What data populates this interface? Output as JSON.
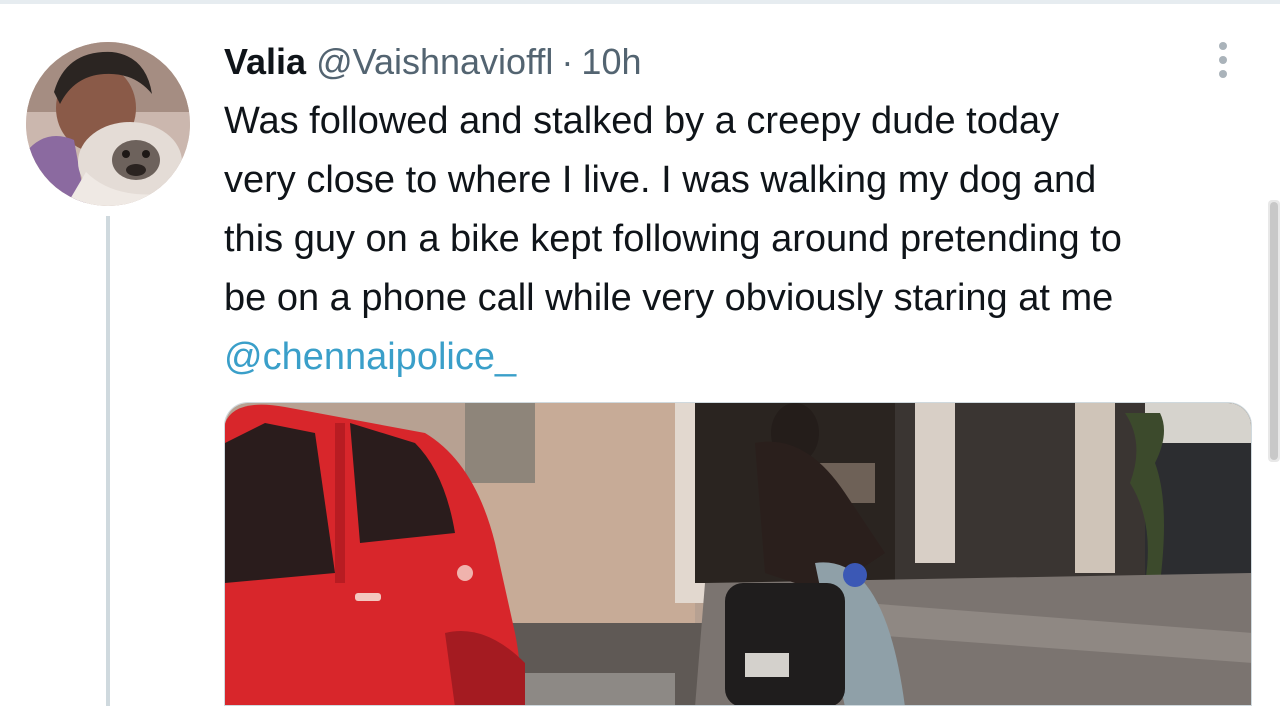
{
  "tweet": {
    "display_name": "Valia",
    "handle": "@Vaishnavioffl",
    "separator": "·",
    "time": "10h",
    "text_lines": [
      "Was followed and stalked by a creepy dude today",
      "very close to where I live. I was walking my dog and",
      "this guy on a bike kept following around pretending to",
      "be on a phone call while very obviously staring at me"
    ],
    "mention": "@chennaipolice_"
  },
  "icons": {
    "more": "more-horizontal-icon",
    "avatar": "avatar-photo"
  },
  "colors": {
    "text": "#0f1419",
    "secondary": "#536471",
    "mention": "#3a9fc9",
    "thread_line": "#cfd9de",
    "car_red": "#d8262b"
  }
}
